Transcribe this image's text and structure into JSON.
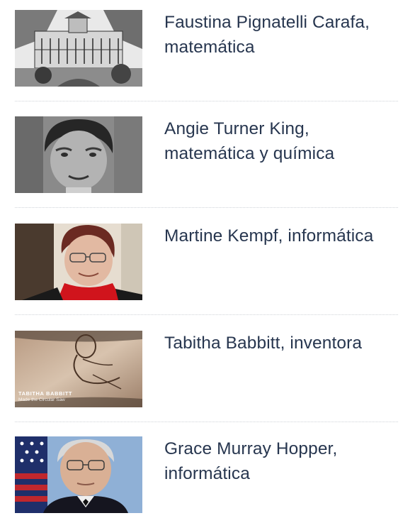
{
  "items": [
    {
      "title": "Faustina Pignatelli Carafa, matemática",
      "thumbnail": "engraving-palace-image"
    },
    {
      "title": "Angie Turner King, matemática y química",
      "thumbnail": "portrait-woman-bw-image"
    },
    {
      "title": "Martine Kempf, informática",
      "thumbnail": "portrait-woman-red-scarf-image"
    },
    {
      "title": "Tabitha Babbitt, inventora",
      "thumbnail": "sketch-woman-image",
      "caption_line1": "TABITHA BABBITT",
      "caption_line2": "Made the Circular Saw"
    },
    {
      "title": "Grace Murray Hopper, informática",
      "thumbnail": "portrait-woman-uniform-flag-image"
    }
  ]
}
